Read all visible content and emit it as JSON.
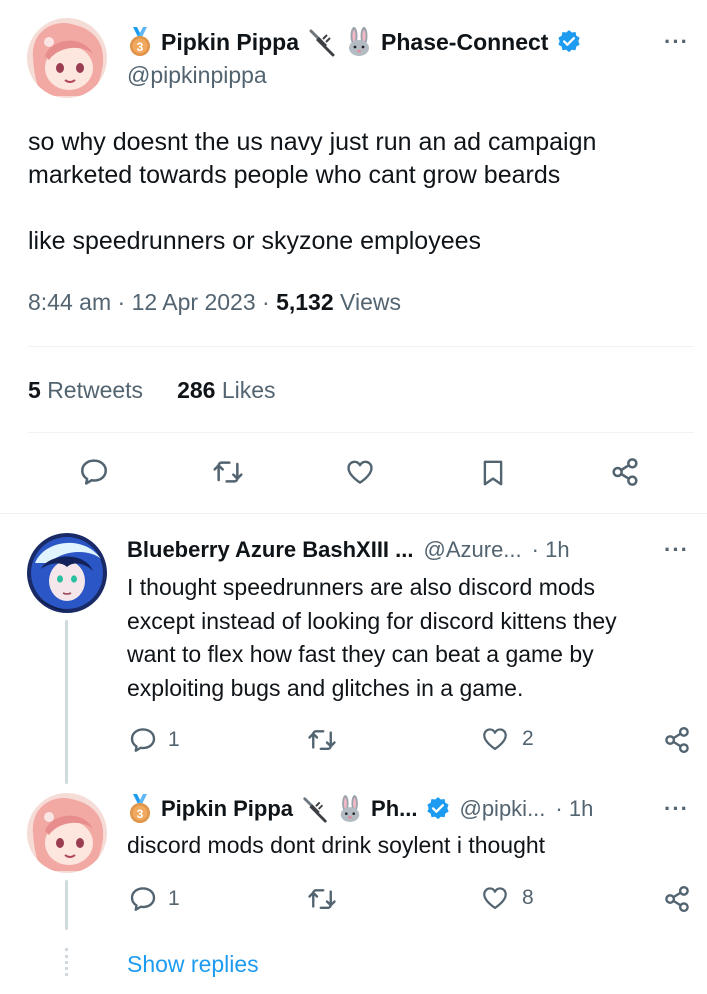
{
  "main_tweet": {
    "author_name": "Pipkin Pippa",
    "author_affiliation": "Phase-Connect",
    "author_handle": "@pipkinpippa",
    "text_line1": "so why doesnt the us navy just run an ad campaign",
    "text_line2": "marketed towards people who cant grow beards",
    "text_line3": "like speedrunners or skyzone employees",
    "time": "8:44 am",
    "date": "12 Apr 2023",
    "views_count": "5,132",
    "views_label": "Views",
    "retweets_count": "5",
    "retweets_label": "Retweets",
    "likes_count": "286",
    "likes_label": "Likes"
  },
  "replies": [
    {
      "author_name": "Blueberry Azure BashXIII ...",
      "author_handle": "@Azure...",
      "time": "· 1h",
      "text": [
        "I thought speedrunners are also discord mods",
        "except instead of looking for discord kittens they",
        "want to flex how fast they can beat a game by",
        "exploiting bugs and glitches in a game."
      ],
      "reply_count": "1",
      "retweet_count": "",
      "like_count": "2"
    },
    {
      "author_name": "Pipkin Pippa",
      "author_affiliation": "Ph...",
      "author_handle": "@pipki...",
      "time": "· 1h",
      "text": [
        "discord mods dont drink soylent i thought"
      ],
      "reply_count": "1",
      "retweet_count": "",
      "like_count": "8"
    }
  ],
  "show_replies_label": "Show replies",
  "colors": {
    "accent": "#1d9bf0",
    "text_primary": "#0f1419",
    "text_secondary": "#536471",
    "divider": "#eff3f4",
    "thread_line": "#cfd9de",
    "verified_badge": "#1d9bf0",
    "medal": "#cd7f32"
  }
}
